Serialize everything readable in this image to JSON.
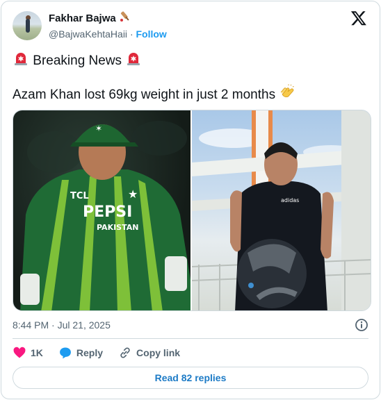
{
  "author": {
    "name": "Fakhar Bajwa",
    "handle": "@BajwaKehtaHaii",
    "separator": "·",
    "follow_label": "Follow"
  },
  "tweet": {
    "line1": "Breaking News",
    "line2": "Azam Khan lost 69kg weight in just 2 months",
    "timestamp": "8:44 PM · Jul 21, 2025"
  },
  "media": {
    "left_jersey_brand": "TCL",
    "left_jersey_sponsor": "PEPSI",
    "left_jersey_country": "PAKISTAN",
    "right_shirt_brand": "adidas"
  },
  "actions": {
    "likes": "1K",
    "reply_label": "Reply",
    "copy_label": "Copy link"
  },
  "read_replies_label": "Read 82 replies",
  "colors": {
    "accent": "#1d9bf0",
    "like": "#f91880",
    "border": "#cfd9de",
    "muted": "#536471"
  },
  "icons": [
    "x-logo-icon",
    "cricket-bat-icon",
    "siren-icon",
    "clapping-hands-icon",
    "info-icon",
    "heart-icon",
    "reply-icon",
    "link-icon"
  ]
}
